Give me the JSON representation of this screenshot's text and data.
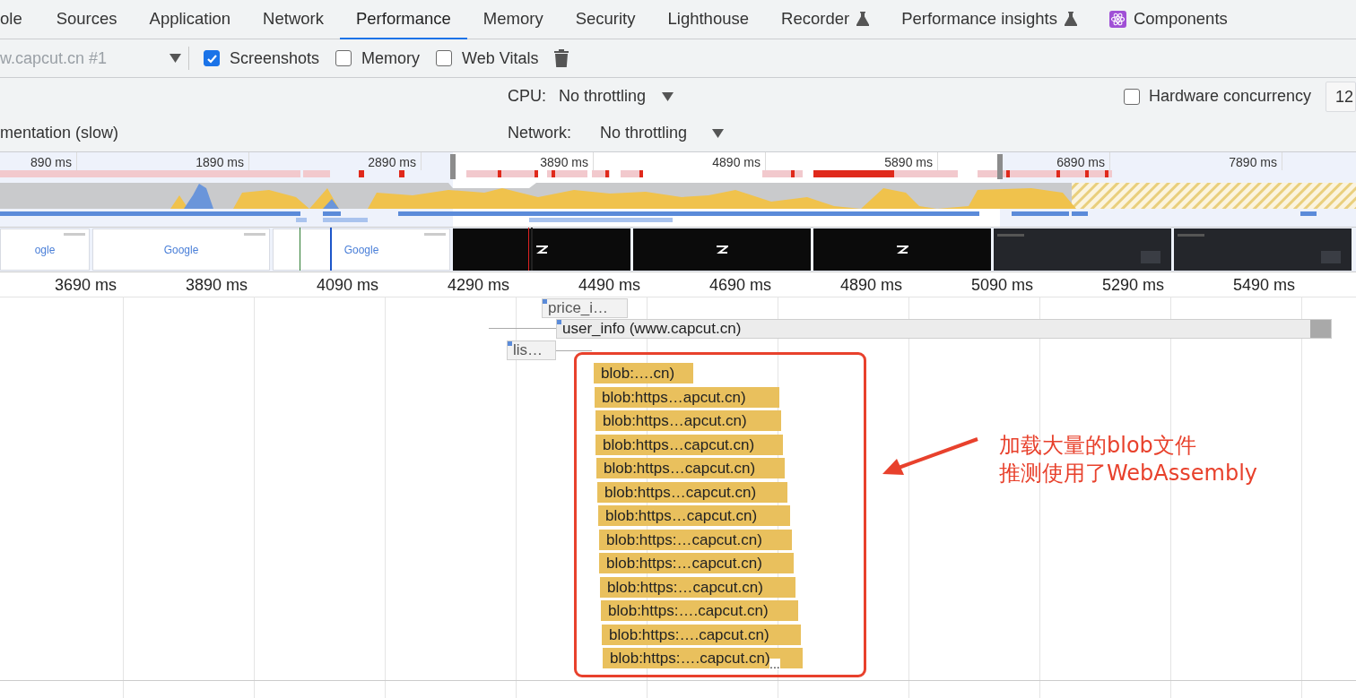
{
  "tabs": [
    {
      "label": "ole",
      "selected": false,
      "kind": "plain"
    },
    {
      "label": "Sources",
      "selected": false,
      "kind": "plain"
    },
    {
      "label": "Application",
      "selected": false,
      "kind": "plain"
    },
    {
      "label": "Network",
      "selected": false,
      "kind": "plain"
    },
    {
      "label": "Performance",
      "selected": true,
      "kind": "plain"
    },
    {
      "label": "Memory",
      "selected": false,
      "kind": "plain"
    },
    {
      "label": "Security",
      "selected": false,
      "kind": "plain"
    },
    {
      "label": "Lighthouse",
      "selected": false,
      "kind": "plain"
    },
    {
      "label": "Recorder",
      "selected": false,
      "kind": "experiment"
    },
    {
      "label": "Performance insights",
      "selected": false,
      "kind": "experiment"
    },
    {
      "label": "Components",
      "selected": false,
      "kind": "react"
    }
  ],
  "toolbar": {
    "target": "w.capcut.cn #1",
    "checkboxes": [
      {
        "label": "Screenshots",
        "checked": true
      },
      {
        "label": "Memory",
        "checked": false
      },
      {
        "label": "Web Vitals",
        "checked": false
      }
    ]
  },
  "settings": {
    "left_text": "mentation (slow)",
    "cpu": {
      "label": "CPU:",
      "value": "No throttling"
    },
    "network": {
      "label": "Network:",
      "value": "No throttling"
    },
    "hardware": {
      "label": "Hardware concurrency",
      "checked": false,
      "value": "12"
    }
  },
  "overview": {
    "ticks": [
      "890 ms",
      "1890 ms",
      "2890 ms",
      "3890 ms",
      "4890 ms",
      "5890 ms",
      "6890 ms",
      "7890 ms"
    ]
  },
  "filmstrip": [
    {
      "kind": "light",
      "logo": "ogle"
    },
    {
      "kind": "light",
      "logo": "Google"
    },
    {
      "kind": "light",
      "logo": "Google"
    },
    {
      "kind": "splash"
    },
    {
      "kind": "splash"
    },
    {
      "kind": "splash"
    },
    {
      "kind": "app"
    },
    {
      "kind": "app"
    }
  ],
  "timeline": {
    "ticks": [
      "3690 ms",
      "3890 ms",
      "4090 ms",
      "4290 ms",
      "4490 ms",
      "4690 ms",
      "4890 ms",
      "5090 ms",
      "5290 ms",
      "5490 ms"
    ],
    "requests": [
      {
        "label": "price_i…"
      },
      {
        "label": "user_info (www.capcut.cn)"
      },
      {
        "label": "lis…"
      }
    ],
    "blobs": [
      "blob:….cn)",
      "blob:https…apcut.cn)",
      "blob:https…apcut.cn)",
      "blob:https…capcut.cn)",
      "blob:https…capcut.cn)",
      "blob:https…capcut.cn)",
      "blob:https…capcut.cn)",
      "blob:https:…capcut.cn)",
      "blob:https:…capcut.cn)",
      "blob:https:…capcut.cn)",
      "blob:https:….capcut.cn)",
      "blob:https:….capcut.cn)",
      "blob:https:….capcut.cn)"
    ],
    "more": "..."
  },
  "annotation": {
    "lines": [
      "加载大量的blob文件",
      "推测使用了WebAssembly"
    ]
  }
}
